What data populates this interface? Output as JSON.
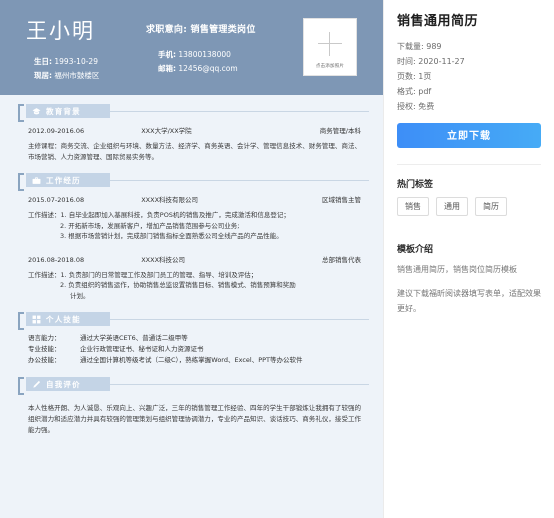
{
  "resume": {
    "header": {
      "name": "王小明",
      "objective": "求职意向: 销售管理类岗位",
      "birthday_label": "生日:",
      "birthday_value": "1993-10-29",
      "residence_label": "现居:",
      "residence_value": "福州市鼓楼区",
      "phone_label": "手机:",
      "phone_value": "13800138000",
      "email_label": "邮箱:",
      "email_value": "12456@qq.com",
      "photo_placeholder": "点击添加照片"
    },
    "sections": [
      {
        "id": "education",
        "icon": "graduation-cap-icon",
        "title": "教育背景",
        "entries": [
          {
            "date": "2012.09-2016.06",
            "org": "XXX大学/XX学院",
            "role": "商务管理/本科",
            "desc_paras": [
              "主修课程：商务交流、企业组织与环境、数量方法、经济学、商务英语、会计学、管理信息技术、财务管理、商法、市场营销、人力资源管理、国际贸易实务等。"
            ]
          }
        ]
      },
      {
        "id": "work",
        "icon": "briefcase-icon",
        "title": "工作经历",
        "entries": [
          {
            "date": "2015.07-2016.08",
            "org": "XXXX科技有限公司",
            "role": "区域销售主管",
            "desc_lines": [
              "工作描述：1. 自毕业起即加入基展科技，负责POS机的销售及推广，完成激活和信息登记；",
              "2. 开拓新市场，发展新客户，增加产品销售范围参与公司业务;",
              "3. 根据市场营销计划，完成部门销售指标全面熟悉公司全线产品的产品性能。"
            ]
          },
          {
            "date": "2016.08-2018.08",
            "org": "XXXX科技公司",
            "role": "总部销售代表",
            "desc_lines": [
              "工作描述：1. 负责部门的日常管理工作及部门员工的管理、指导、培训及评估；",
              "2. 负责组织的销售运作，协助销售总监设置销售目标、销售模式、销售预算和奖励",
              "计划。"
            ]
          }
        ]
      },
      {
        "id": "skills",
        "icon": "grid-icon",
        "title": "个人技能",
        "skills": [
          {
            "label": "语言能力：",
            "value": "通过大学英语CET6、普通话二级甲等"
          },
          {
            "label": "专业技能：",
            "value": "企业行政管理证书、秘书证和人力资源证书"
          },
          {
            "label": "办公技能：",
            "value": "通过全国计算机等级考试（二级C），熟练掌握Word、Excel、PPT等办公软件"
          }
        ]
      },
      {
        "id": "self-evaluation",
        "icon": "pencil-icon",
        "title": "自我评价",
        "text": "本人性格开朗、为人诚恳、乐观向上、兴趣广泛，三年的销售管理工作经验、四年的学生干部锻炼让我拥有了较强的组织潜力和适应潜力并具有较强的管理策划与组织管理协调潜力，专业的产品知识、谈话技巧、商务礼仪，接受工作能力强。"
      }
    ]
  },
  "panel": {
    "title": "销售通用简历",
    "meta": [
      "下载量: 989",
      "时间: 2020-11-27",
      "页数: 1页",
      "格式: pdf",
      "授权: 免费"
    ],
    "download_label": "立即下载",
    "tags_title": "热门标签",
    "tags": [
      "销售",
      "通用",
      "简历"
    ],
    "intro_title": "模板介绍",
    "intro_paras": [
      "销售通用简历，销售岗位简历模板",
      "建议下载福昕阅读器填写表单，适配效果更好。"
    ]
  },
  "colors": {
    "header_bg": "#7e97b5",
    "resume_bg": "#eef3f9",
    "section_tab": "#c4d4e6",
    "accent_button": "#3d8ef7"
  }
}
